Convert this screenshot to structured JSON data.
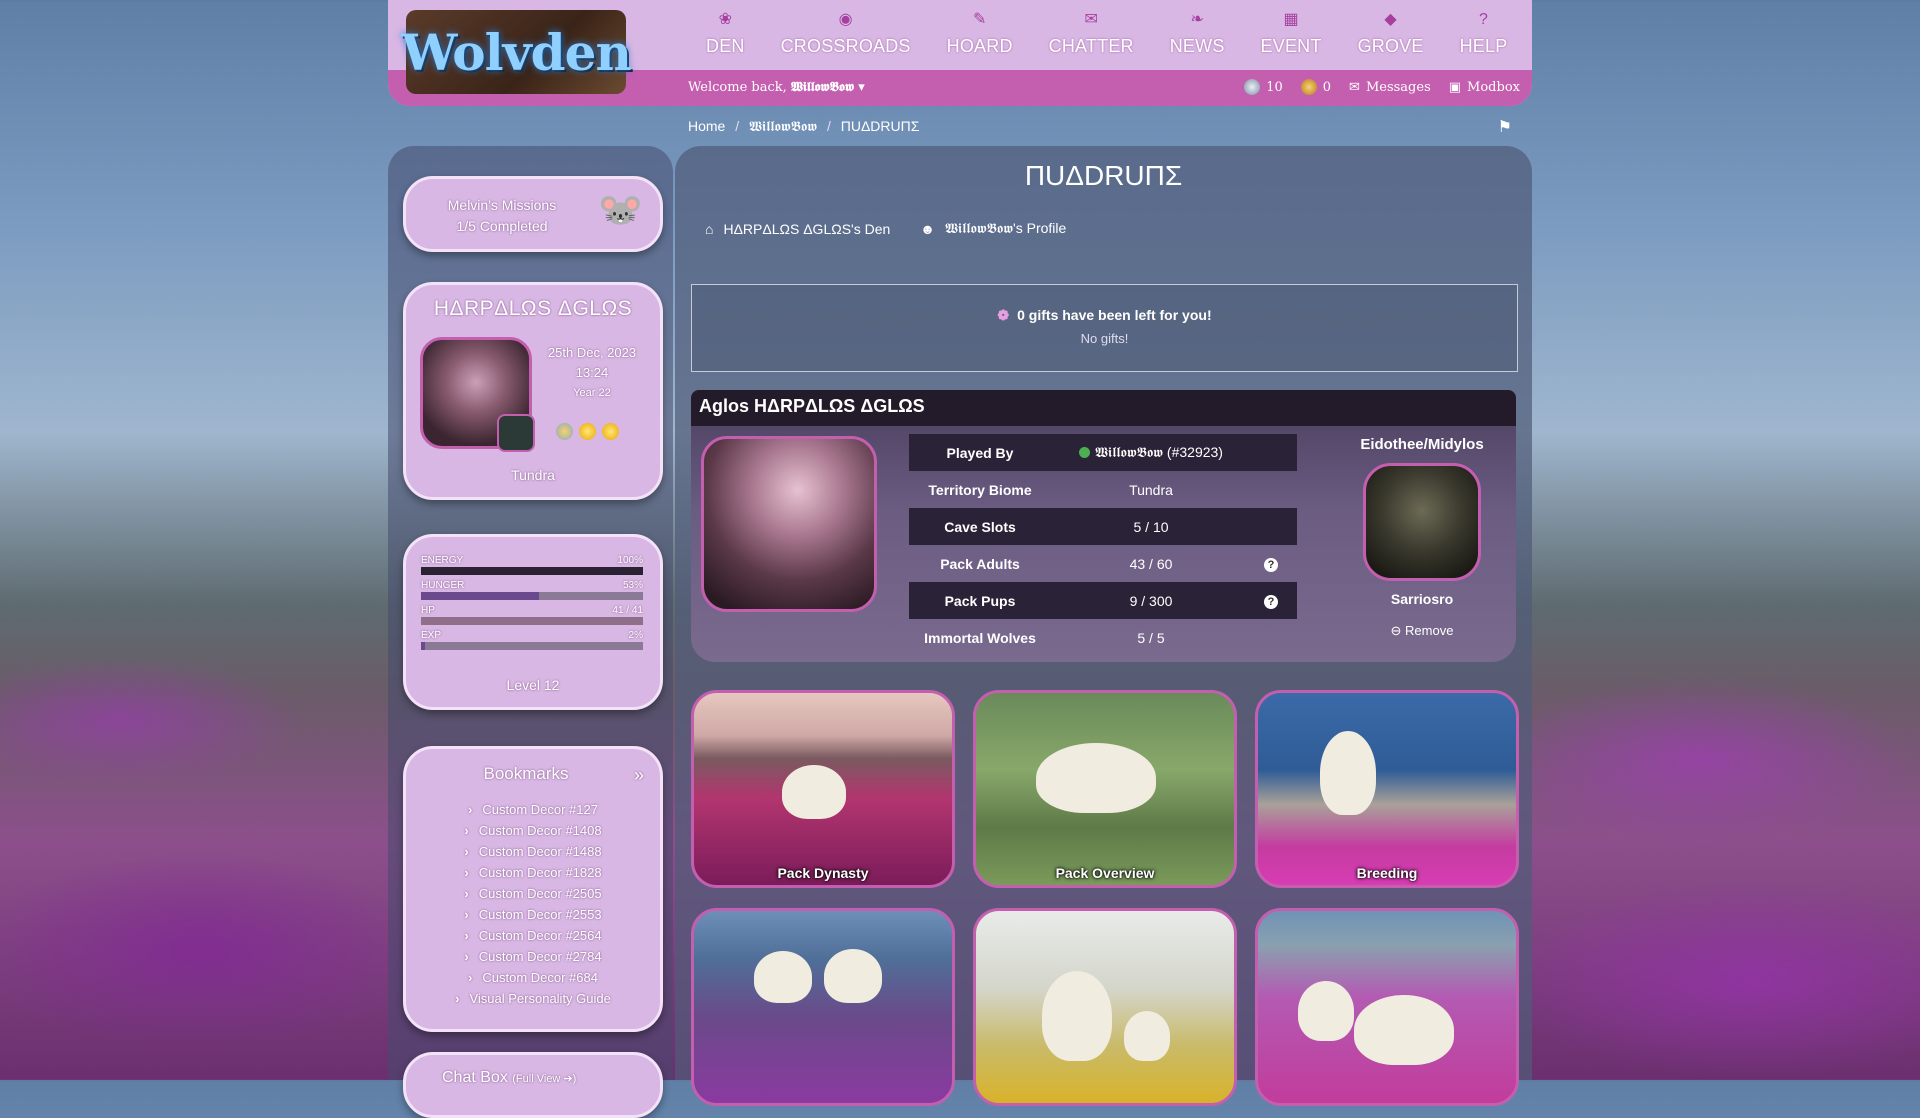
{
  "header": {
    "logo": "Wolvden",
    "nav": [
      {
        "label": "DEN",
        "icon": "paw-icon",
        "glyph": "❀"
      },
      {
        "label": "CROSSROADS",
        "icon": "compass-icon",
        "glyph": "◉"
      },
      {
        "label": "HOARD",
        "icon": "bone-icon",
        "glyph": "✎"
      },
      {
        "label": "CHATTER",
        "icon": "chat-bubbles-icon",
        "glyph": "✉"
      },
      {
        "label": "NEWS",
        "icon": "leaf-icon",
        "glyph": "❧"
      },
      {
        "label": "EVENT",
        "icon": "calendar-icon",
        "glyph": "▦"
      },
      {
        "label": "GROVE",
        "icon": "gem-icon",
        "glyph": "◆"
      },
      {
        "label": "HELP",
        "icon": "question-icon",
        "glyph": "?"
      }
    ],
    "welcome_prefix": "Welcome back,",
    "username": "𝖂𝖎𝖑𝖑𝖔𝖜𝕭𝖔𝖜",
    "caret": "▾",
    "currency_gems": "10",
    "currency_coins": "0",
    "messages_label": "Messages",
    "modbox_label": "Modbox"
  },
  "breadcrumb": {
    "home": "Home",
    "user": "𝖂𝖎𝖑𝖑𝖔𝖜𝕭𝖔𝖜",
    "page": "ΠUΔDRUΠΣ",
    "sep": "/"
  },
  "sidebar": {
    "missions_title": "Melvin's Missions",
    "missions_progress": "1/5 Completed",
    "wolf_name": "HΔRPΔLΩS ΔGLΩS",
    "wolf_date": "25th Dec, 2023",
    "wolf_time": "13:24",
    "wolf_year": "Year 22",
    "wolf_biome": "Tundra",
    "stats": [
      {
        "label": "ENERGY",
        "value": "100%",
        "fill": 1.0,
        "color": "#2a2232"
      },
      {
        "label": "HUNGER",
        "value": "53%",
        "fill": 0.53,
        "color": "#6a4a8c"
      },
      {
        "label": "HP",
        "value": "41 / 41",
        "fill": 1.0,
        "color": "#8e6e88"
      },
      {
        "label": "EXP",
        "value": "2%",
        "fill": 0.02,
        "color": "#6a4a8c"
      }
    ],
    "level": "Level 12",
    "bookmarks_title": "Bookmarks",
    "bookmarks_chev": "»",
    "bookmarks": [
      "Custom Decor #127",
      "Custom Decor #1408",
      "Custom Decor #1488",
      "Custom Decor #1828",
      "Custom Decor #2505",
      "Custom Decor #2553",
      "Custom Decor #2564",
      "Custom Decor #2784",
      "Custom Decor #684",
      "Visual Personality Guide"
    ],
    "chat_title": "Chat Box",
    "chat_sub": "(Full View ➔)"
  },
  "main": {
    "title": "ΠUΔDRUΠΣ",
    "den_link": "HΔRPΔLΩS ΔGLΩS's Den",
    "profile_link_user": "𝖂𝖎𝖑𝖑𝖔𝖜𝕭𝖔𝖜",
    "profile_link_suffix": "'s Profile",
    "gifts_line": "0 gifts have been left for you!",
    "gifts_sub": "No gifts!",
    "pack_title": "Aglos HΔRPΔLΩS ΔGLΩS",
    "pack_rows": [
      {
        "k": "Played By",
        "v": "𝖂𝖎𝖑𝖑𝖔𝖜𝕭𝖔𝖜 (#32923)",
        "dot": true,
        "q": false
      },
      {
        "k": "Territory Biome",
        "v": "Tundra",
        "q": false
      },
      {
        "k": "Cave Slots",
        "v": "5 / 10",
        "q": false
      },
      {
        "k": "Pack Adults",
        "v": "43 / 60",
        "q": true
      },
      {
        "k": "Pack Pups",
        "v": "9 / 300",
        "q": true
      },
      {
        "k": "Immortal Wolves",
        "v": "5 / 5",
        "q": false
      }
    ],
    "leader_title": "Eidothee/Midylos",
    "leader_name": "Sarriosro",
    "remove_label": "Remove",
    "tiles": [
      "Pack Dynasty",
      "Pack Overview",
      "Breeding",
      "",
      "",
      ""
    ]
  }
}
